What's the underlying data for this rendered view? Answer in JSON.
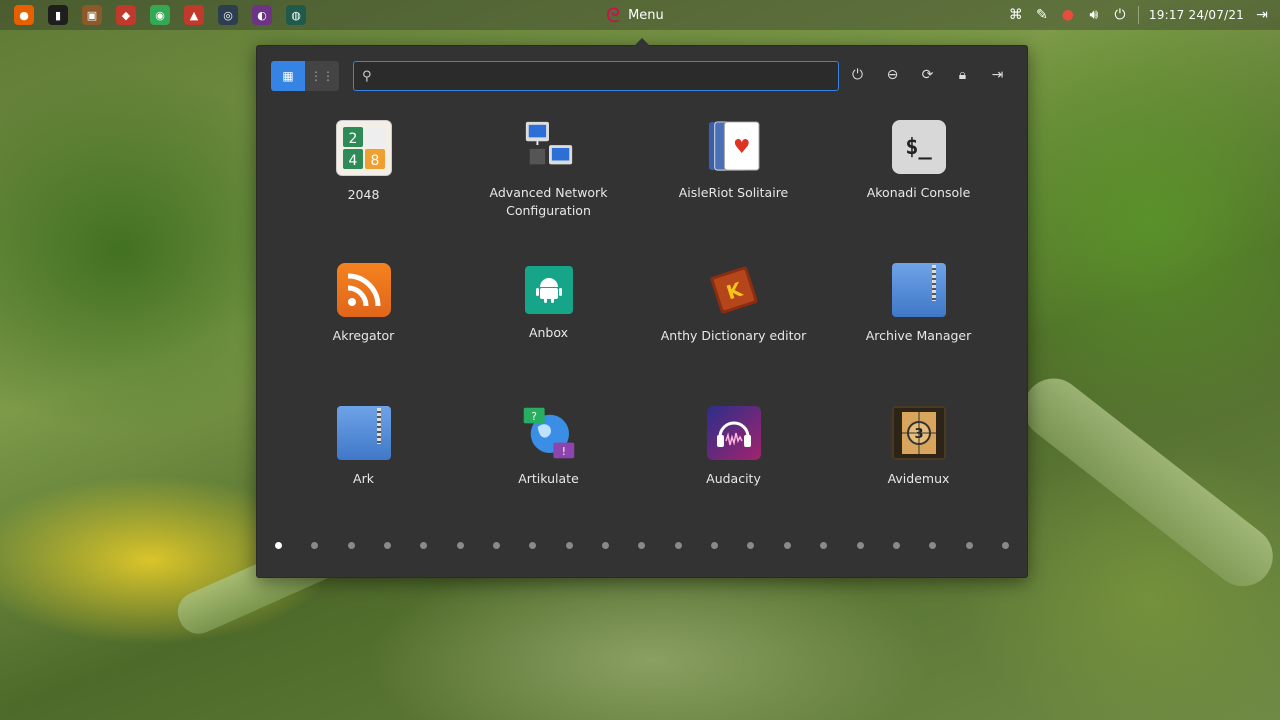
{
  "panel": {
    "launchers": [
      {
        "name": "firefox-launcher-icon",
        "color": "#e66000",
        "glyph": "●"
      },
      {
        "name": "terminal-launcher-icon",
        "color": "#1e1e1e",
        "glyph": "▮"
      },
      {
        "name": "media-launcher-icon",
        "color": "#8a5a2a",
        "glyph": "▣"
      },
      {
        "name": "store-launcher-icon",
        "color": "#c0392b",
        "glyph": "◆"
      },
      {
        "name": "chrome-launcher-icon",
        "color": "#34a853",
        "glyph": "◉"
      },
      {
        "name": "home-launcher-icon",
        "color": "#c0392b",
        "glyph": "▲"
      },
      {
        "name": "camera-launcher-icon",
        "color": "#2c3e50",
        "glyph": "◎"
      },
      {
        "name": "headphones-launcher-icon",
        "color": "#6c3483",
        "glyph": "◐"
      },
      {
        "name": "disk-launcher-icon",
        "color": "#1f5a4a",
        "glyph": "◍"
      }
    ],
    "menu_label": "Menu",
    "clock": "19:17 24/07/21"
  },
  "popup": {
    "search_placeholder": "",
    "apps": [
      {
        "name": "2048",
        "label": "2048"
      },
      {
        "name": "advanced-network-configuration",
        "label": "Advanced Network Configuration"
      },
      {
        "name": "aisleriot-solitaire",
        "label": "AisleRiot Solitaire"
      },
      {
        "name": "akonadi-console",
        "label": "Akonadi Console"
      },
      {
        "name": "akregator",
        "label": "Akregator"
      },
      {
        "name": "anbox",
        "label": "Anbox"
      },
      {
        "name": "anthy-dictionary-editor",
        "label": "Anthy Dictionary editor"
      },
      {
        "name": "archive-manager",
        "label": "Archive Manager"
      },
      {
        "name": "ark",
        "label": "Ark"
      },
      {
        "name": "artikulate",
        "label": "Artikulate"
      },
      {
        "name": "audacity",
        "label": "Audacity"
      },
      {
        "name": "avidemux",
        "label": "Avidemux"
      }
    ],
    "page_count": 21,
    "current_page": 1
  }
}
